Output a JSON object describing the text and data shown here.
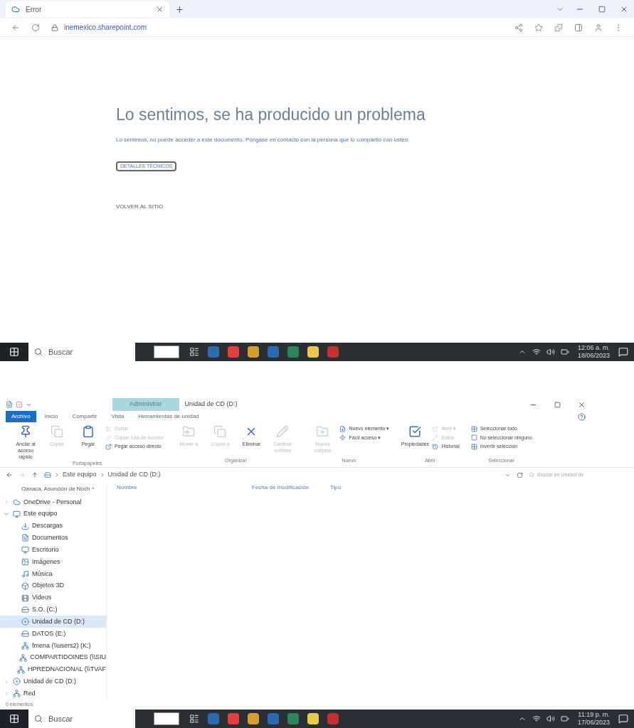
{
  "browser": {
    "tab_title": "Error",
    "url": "inemexico.sharepoint.com",
    "heading": "Lo sentimos, se ha producido un problema",
    "message": "Lo sentimos, no puede acceder a este documento. Póngase en contacto con la persona que lo compartió con usted.",
    "details_button": "DETALLES TÉCNICOS",
    "back_link": "VOLVER AL SITIO",
    "taskbar": {
      "search_placeholder": "Buscar",
      "time": "12:06 a. m.",
      "date": "18/06/2023"
    }
  },
  "explorer": {
    "context_tab": "Administrar",
    "title": "Unidad de CD (D:)",
    "tabs": [
      {
        "label": "Archivo",
        "selected": true
      },
      {
        "label": "Inicio",
        "selected": false
      },
      {
        "label": "Compartir",
        "selected": false
      },
      {
        "label": "Vista",
        "selected": false
      },
      {
        "label": "Herramientas de unidad",
        "selected": false
      }
    ],
    "ribbon_groups": [
      {
        "label": "Portapapeles",
        "items": [
          {
            "kind": "large",
            "label": "Anclar al acceso rápido",
            "disabled": false
          },
          {
            "kind": "large",
            "label": "Copiar",
            "disabled": true
          },
          {
            "kind": "large",
            "label": "Pegar",
            "disabled": false
          },
          {
            "kind": "small",
            "label": "Cortar",
            "disabled": true
          },
          {
            "kind": "small",
            "label": "Copiar ruta de acceso",
            "disabled": true
          },
          {
            "kind": "small",
            "label": "Pegar acceso directo",
            "disabled": false
          }
        ]
      },
      {
        "label": "Organizar",
        "items": [
          {
            "kind": "large",
            "label": "Mover a",
            "disabled": true
          },
          {
            "kind": "large",
            "label": "Copiar a",
            "disabled": true
          },
          {
            "kind": "large",
            "label": "Eliminar",
            "disabled": false
          },
          {
            "kind": "large",
            "label": "Cambiar nombre",
            "disabled": true
          }
        ]
      },
      {
        "label": "Nuevo",
        "items": [
          {
            "kind": "large",
            "label": "Nueva carpeta",
            "disabled": true
          },
          {
            "kind": "small",
            "label": "Nuevo elemento ▾",
            "disabled": false
          },
          {
            "kind": "small",
            "label": "Fácil acceso ▾",
            "disabled": false
          }
        ]
      },
      {
        "label": "Abrir",
        "items": [
          {
            "kind": "large",
            "label": "Propiedades",
            "disabled": false
          },
          {
            "kind": "small",
            "label": "Abrir ▾",
            "disabled": true
          },
          {
            "kind": "small",
            "label": "Editar",
            "disabled": true
          },
          {
            "kind": "small",
            "label": "Historial",
            "disabled": false
          }
        ]
      },
      {
        "label": "Seleccionar",
        "items": [
          {
            "kind": "small",
            "label": "Seleccionar todo",
            "disabled": false
          },
          {
            "kind": "small",
            "label": "No seleccionar ninguno",
            "disabled": false
          },
          {
            "kind": "small",
            "label": "Invertir selección",
            "disabled": false
          }
        ]
      }
    ],
    "breadcrumb": [
      "Este equipo",
      "Unidad de CD (D:)"
    ],
    "search_placeholder": "Buscar en Unidad de",
    "nav_header": "Oaxaca, Asunción de Noch ^",
    "tree": [
      {
        "label": "OneDrive - Personal",
        "expanded": false,
        "selected": false
      },
      {
        "label": "Este equipo",
        "expanded": true,
        "selected": false,
        "children": [
          {
            "label": "Descargas",
            "selected": false
          },
          {
            "label": "Documentos",
            "selected": false
          },
          {
            "label": "Escritorio",
            "selected": false
          },
          {
            "label": "Imágenes",
            "selected": false
          },
          {
            "label": "Música",
            "selected": false
          },
          {
            "label": "Objetos 3D",
            "selected": false
          },
          {
            "label": "Videos",
            "selected": false
          },
          {
            "label": "S.O. (C:)",
            "selected": false
          },
          {
            "label": "Unidad de CD (D:)",
            "selected": true
          },
          {
            "label": "DATOS (E:)",
            "selected": false
          },
          {
            "label": "fmena (\\\\users2) (K:)",
            "selected": false
          },
          {
            "label": "COMPARTIDOINES (\\\\SIU",
            "selected": false
          },
          {
            "label": "HPREDNACIONAL (\\\\TVAF",
            "selected": false
          }
        ]
      },
      {
        "label": "Unidad de CD (D:)",
        "expanded": false,
        "selected": false
      },
      {
        "label": "Red",
        "expanded": false,
        "selected": false
      }
    ],
    "columns": [
      "Nombre",
      "Fecha de modificación",
      "Tipo"
    ],
    "status": "0 elementos",
    "taskbar": {
      "search_placeholder": "Buscar",
      "time": "11:19 p. m.",
      "date": "17/06/2023"
    }
  }
}
